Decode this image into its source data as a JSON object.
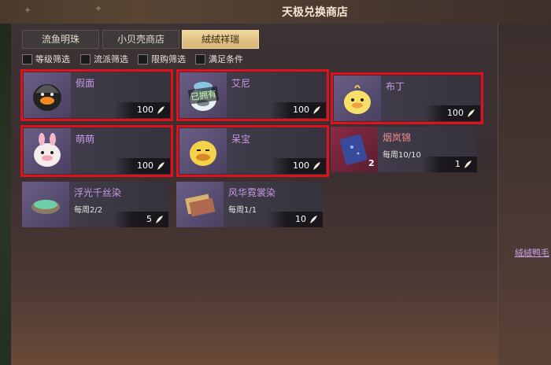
{
  "window": {
    "title": "天极兑换商店"
  },
  "tabs": [
    {
      "label": "流鱼明珠",
      "active": false
    },
    {
      "label": "小贝壳商店",
      "active": false
    },
    {
      "label": "絨絨祥瑞",
      "active": true
    }
  ],
  "filters": [
    {
      "label": "等级筛选",
      "checked": false
    },
    {
      "label": "流派筛选",
      "checked": false
    },
    {
      "label": "限购筛选",
      "checked": false
    },
    {
      "label": "满足条件",
      "checked": false
    }
  ],
  "items": [
    {
      "name": "假面",
      "price": "100",
      "limit": "",
      "qty": "",
      "owned": "",
      "icon": "black-duck-mask-icon",
      "selected": true,
      "rare": false
    },
    {
      "name": "艾尼",
      "price": "100",
      "limit": "",
      "qty": "",
      "owned": "已拥有",
      "icon": "blue-duck-icon",
      "selected": true,
      "rare": false
    },
    {
      "name": "布丁",
      "price": "100",
      "limit": "",
      "qty": "",
      "owned": "",
      "icon": "yellow-chick-icon",
      "selected": true,
      "rare": false
    },
    {
      "name": "萌萌",
      "price": "100",
      "limit": "",
      "qty": "",
      "owned": "",
      "icon": "pink-bunny-duck-icon",
      "selected": true,
      "rare": false
    },
    {
      "name": "呆宝",
      "price": "100",
      "limit": "",
      "qty": "",
      "owned": "",
      "icon": "yellow-duck-icon",
      "selected": true,
      "rare": false
    },
    {
      "name": "烟岚锦",
      "price": "1",
      "limit": "每周10/10",
      "qty": "2",
      "owned": "",
      "icon": "blue-brocade-icon",
      "selected": false,
      "rare": true
    },
    {
      "name": "浮光千丝染",
      "price": "5",
      "limit": "每周2/2",
      "qty": "",
      "owned": "",
      "icon": "dye-bowl-icon",
      "selected": false,
      "rare": false
    },
    {
      "name": "风华霓裳染",
      "price": "10",
      "limit": "每周1/1",
      "qty": "",
      "owned": "",
      "icon": "fabric-bundle-icon",
      "selected": false,
      "rare": false
    }
  ],
  "side": {
    "link_text": "絨絨鸭毛"
  },
  "colors": {
    "selection": "#e0101c",
    "accent_gold": "#d6b474",
    "item_name": "#c79ae6"
  }
}
